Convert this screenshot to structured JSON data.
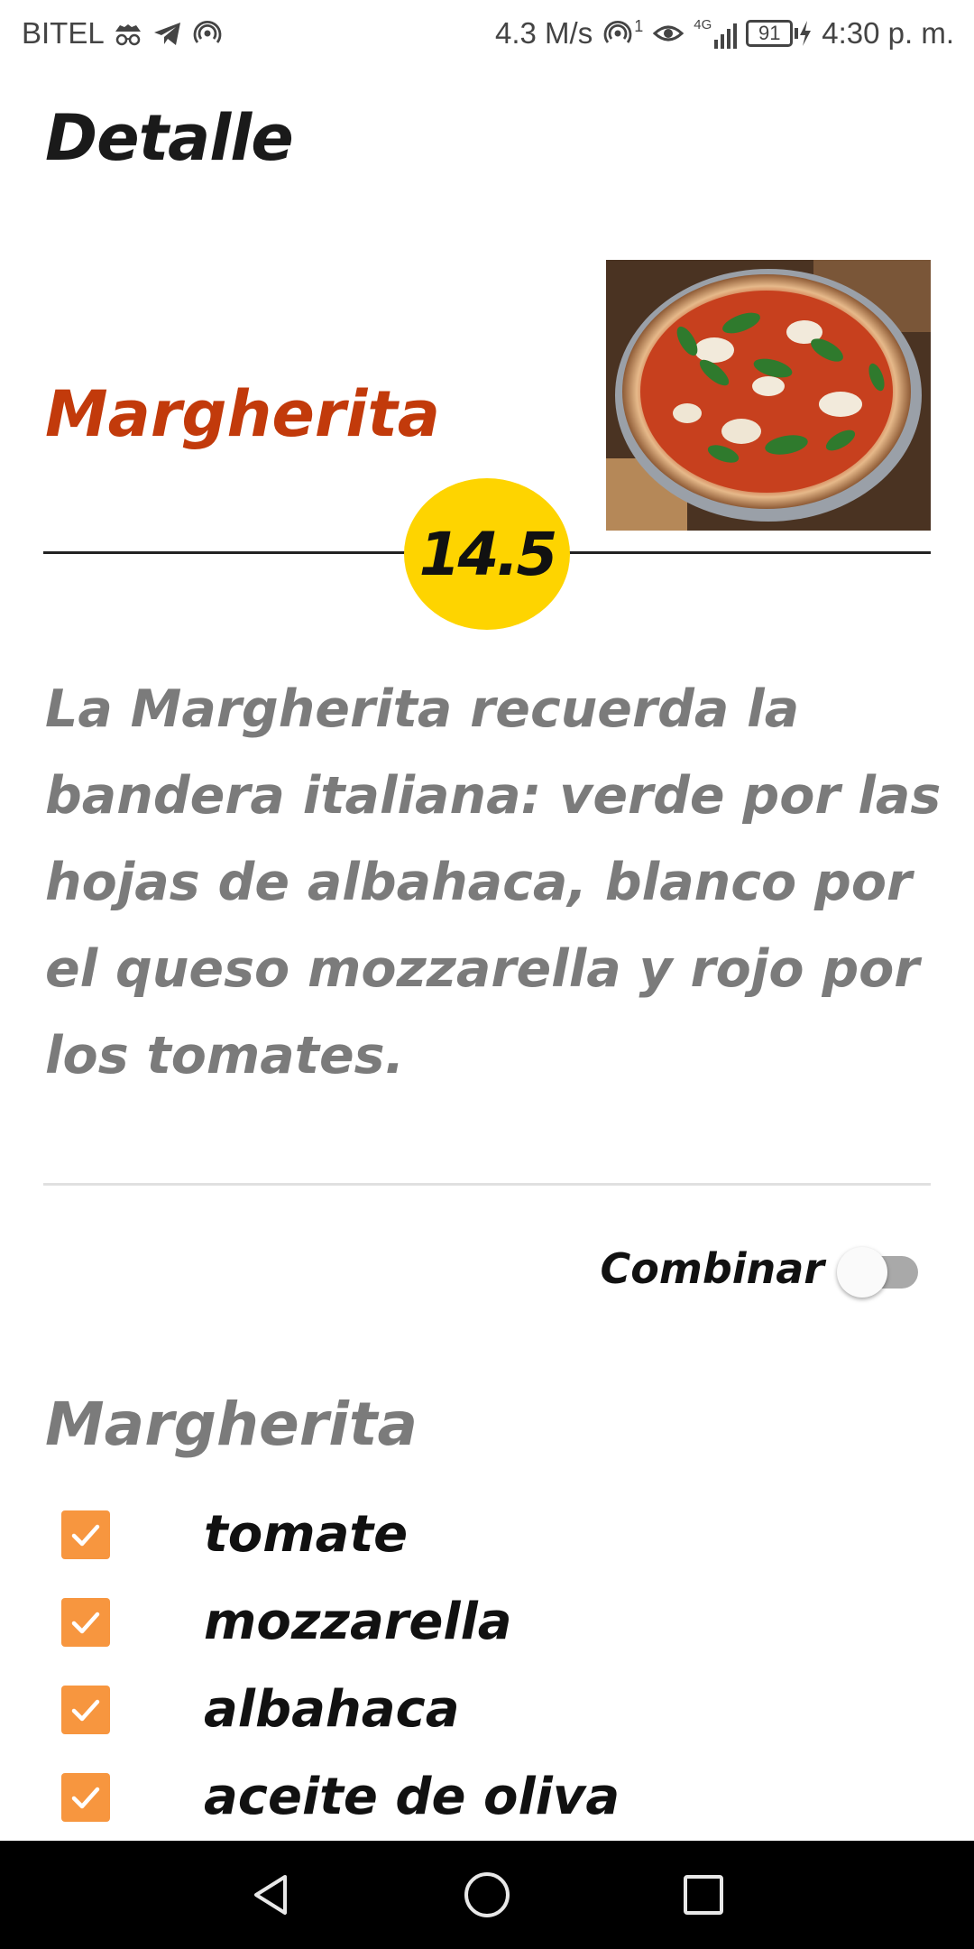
{
  "colors": {
    "accent_name": "#c23a0b",
    "price_bg": "#fed400",
    "checkbox": "#f7963f",
    "muted_text": "#7b7b7b"
  },
  "status_bar": {
    "carrier": "BITEL",
    "left_icons": [
      "incognito-icon",
      "telegram-icon",
      "hotspot-icon"
    ],
    "speed": "4.3 M/s",
    "right_icons": [
      "hotspot-icon",
      "eye-icon",
      "4g-signal-icon"
    ],
    "hotspot_count": "1",
    "network_type": "4G",
    "battery": "91",
    "time": "4:30 p. m."
  },
  "header": {
    "title": "Detalle"
  },
  "pizza": {
    "name": "Margherita",
    "price": "14.5",
    "description": "La Margherita recuerda la bandera italiana: verde por las hojas de albahaca, blanco por el queso mozzarella y rojo por los tomates."
  },
  "combine": {
    "label": "Combinar",
    "checked": false
  },
  "ingredients": {
    "title": "Margherita",
    "items": [
      {
        "label": "tomate",
        "checked": true
      },
      {
        "label": "mozzarella",
        "checked": true
      },
      {
        "label": "albahaca",
        "checked": true
      },
      {
        "label": "aceite de oliva",
        "checked": true
      }
    ]
  },
  "nav": {
    "buttons": [
      "back-icon",
      "home-icon",
      "recents-icon"
    ]
  }
}
